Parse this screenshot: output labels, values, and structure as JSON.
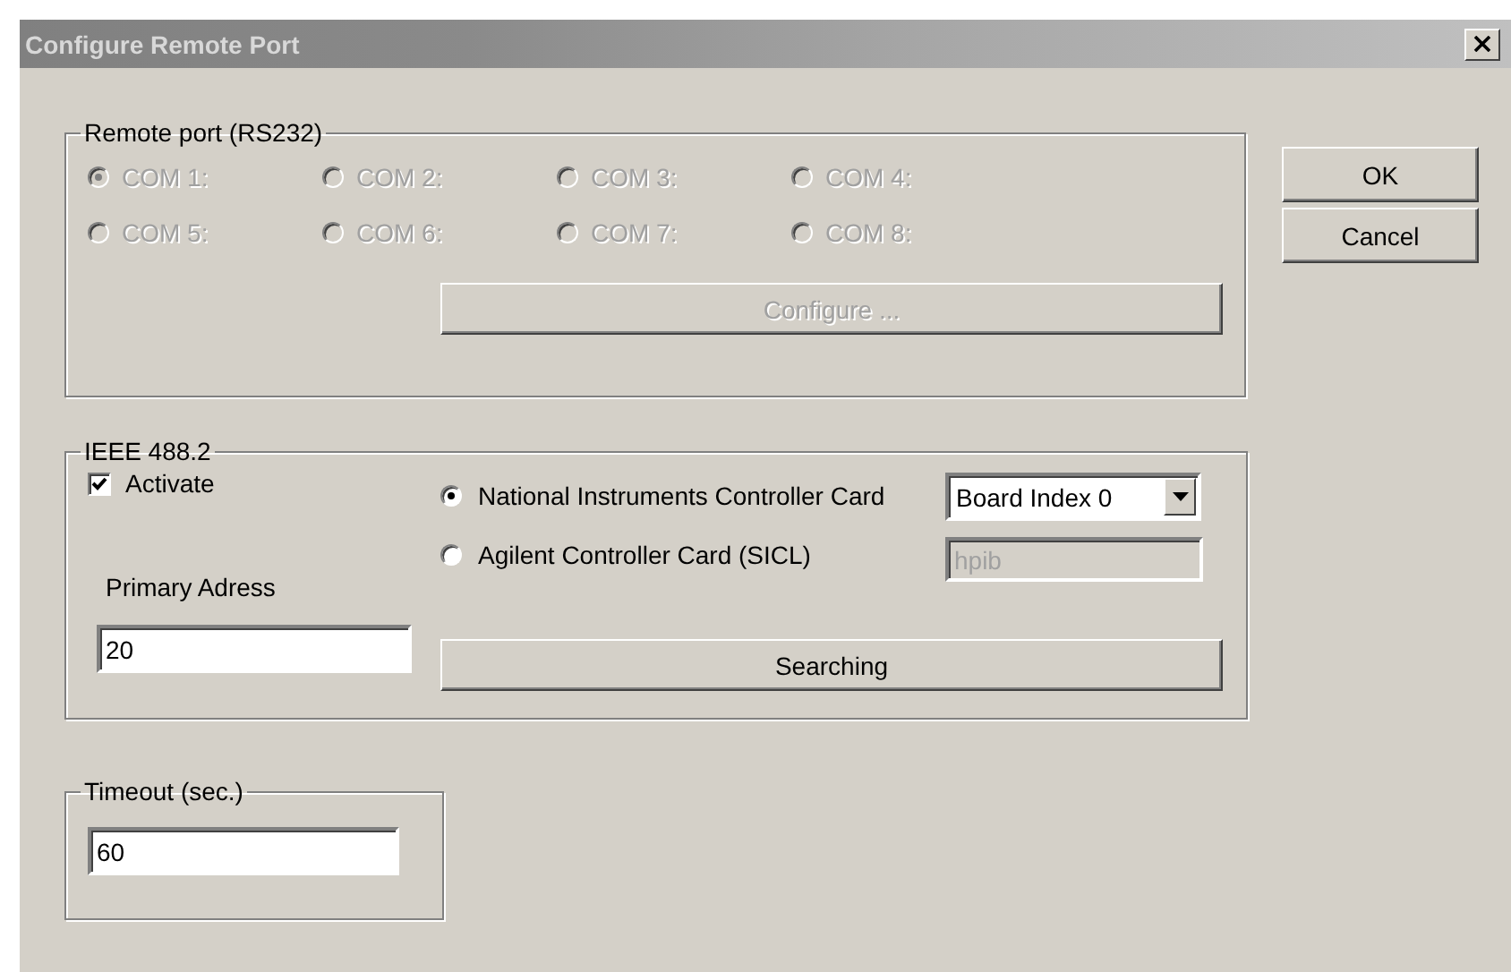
{
  "window": {
    "title": "Configure Remote Port"
  },
  "remote_port": {
    "legend": "Remote port (RS232)",
    "disabled": true,
    "configure_button": "Configure ...",
    "ports": [
      {
        "label": "COM 1:",
        "selected": true
      },
      {
        "label": "COM 2:",
        "selected": false
      },
      {
        "label": "COM 3:",
        "selected": false
      },
      {
        "label": "COM 4:",
        "selected": false
      },
      {
        "label": "COM 5:",
        "selected": false
      },
      {
        "label": "COM 6:",
        "selected": false
      },
      {
        "label": "COM 7:",
        "selected": false
      },
      {
        "label": "COM 8:",
        "selected": false
      }
    ]
  },
  "ieee": {
    "legend": "IEEE 488.2",
    "activate": {
      "label": "Activate",
      "checked": true
    },
    "controllers": [
      {
        "label": "National Instruments Controller Card",
        "selected": true
      },
      {
        "label": "Agilent Controller Card (SICL)",
        "selected": false
      }
    ],
    "board_index": "Board Index 0",
    "sicl_address": {
      "value": "hpib",
      "disabled": true
    },
    "primary_address_label": "Primary Adress",
    "primary_address": "20",
    "search_button": "Searching"
  },
  "timeout": {
    "legend": "Timeout (sec.)",
    "value": "60"
  },
  "buttons": [
    {
      "label": "OK"
    },
    {
      "label": "Cancel"
    }
  ]
}
